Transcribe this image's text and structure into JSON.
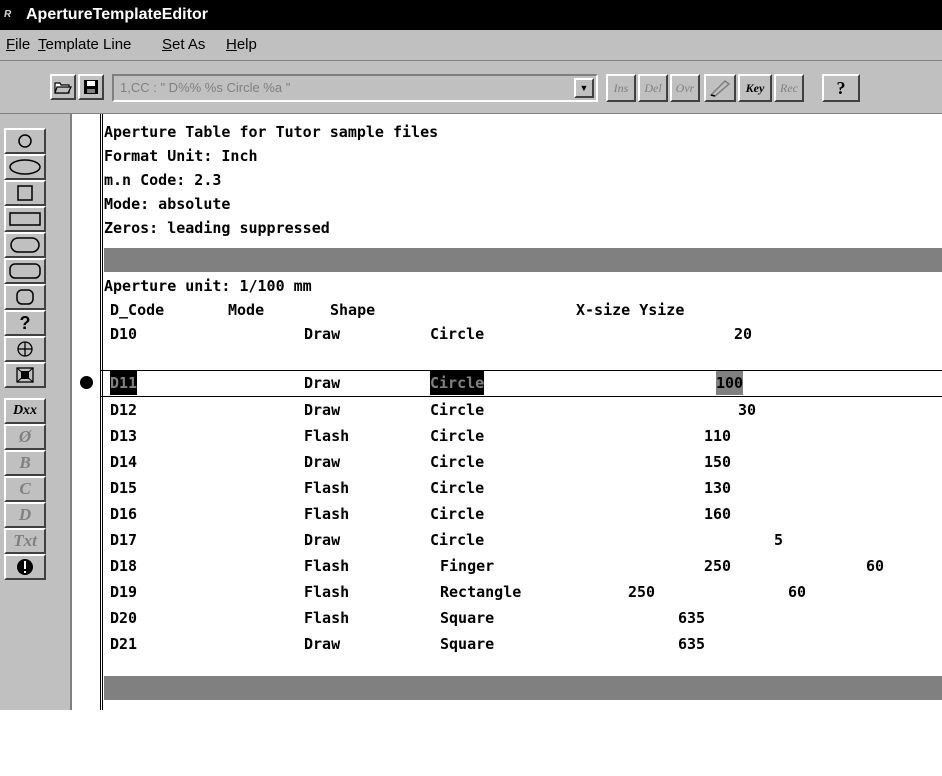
{
  "app": {
    "title": "ApertureTemplateEditor",
    "icon_text": "R"
  },
  "menu": [
    {
      "label": "File"
    },
    {
      "label": "Template Line"
    },
    {
      "label": "Set As"
    },
    {
      "label": "Help"
    }
  ],
  "toolbar": {
    "combo_value": "1,CC : \" D%% %s Circle %a \"",
    "ins": "Ins",
    "del": "Del",
    "ovr": "Ovr",
    "key": "Key",
    "rec": "Rec",
    "help": "?"
  },
  "sidebar": {
    "d_label": "Dxx",
    "diam_label": "Ø",
    "b_label": "B",
    "c_label": "C",
    "dd_label": "D",
    "txt_label": "Txt"
  },
  "editor": {
    "header": [
      "Aperture Table for Tutor sample files",
      "Format Unit: Inch",
      "m.n Code: 2.3",
      "Mode: absolute",
      "Zeros: leading suppressed"
    ],
    "unit_line": "Aperture unit: 1/100 mm",
    "columns": {
      "dcode": "D_Code",
      "mode": "Mode",
      "shape": "Shape",
      "size": "X-size Ysize"
    },
    "rows": [
      {
        "d": "D10",
        "mode": "Draw",
        "shape": "Circle",
        "x": "20",
        "y": ""
      },
      {
        "d": "D11",
        "mode": "Draw",
        "shape": "Circle",
        "x": "100",
        "y": ""
      },
      {
        "d": "D12",
        "mode": "Draw",
        "shape": "Circle",
        "x": "30",
        "y": ""
      },
      {
        "d": "D13",
        "mode": "Flash",
        "shape": "Circle",
        "x": "110",
        "y": ""
      },
      {
        "d": "D14",
        "mode": "Draw",
        "shape": "Circle",
        "x": "150",
        "y": ""
      },
      {
        "d": "D15",
        "mode": "Flash",
        "shape": "Circle",
        "x": "130",
        "y": ""
      },
      {
        "d": "D16",
        "mode": "Flash",
        "shape": "Circle",
        "x": "160",
        "y": ""
      },
      {
        "d": "D17",
        "mode": "Draw",
        "shape": "Circle",
        "x": "5",
        "y": ""
      },
      {
        "d": "D18",
        "mode": "Flash",
        "shape": "Finger",
        "x": "250",
        "y": "60"
      },
      {
        "d": "D19",
        "mode": "Flash",
        "shape": "Rectangle",
        "x": "250",
        "y": "60"
      },
      {
        "d": "D20",
        "mode": "Flash",
        "shape": "Square",
        "x": "635",
        "y": ""
      },
      {
        "d": "D21",
        "mode": "Draw",
        "shape": "Square",
        "x": "635",
        "y": ""
      }
    ]
  }
}
